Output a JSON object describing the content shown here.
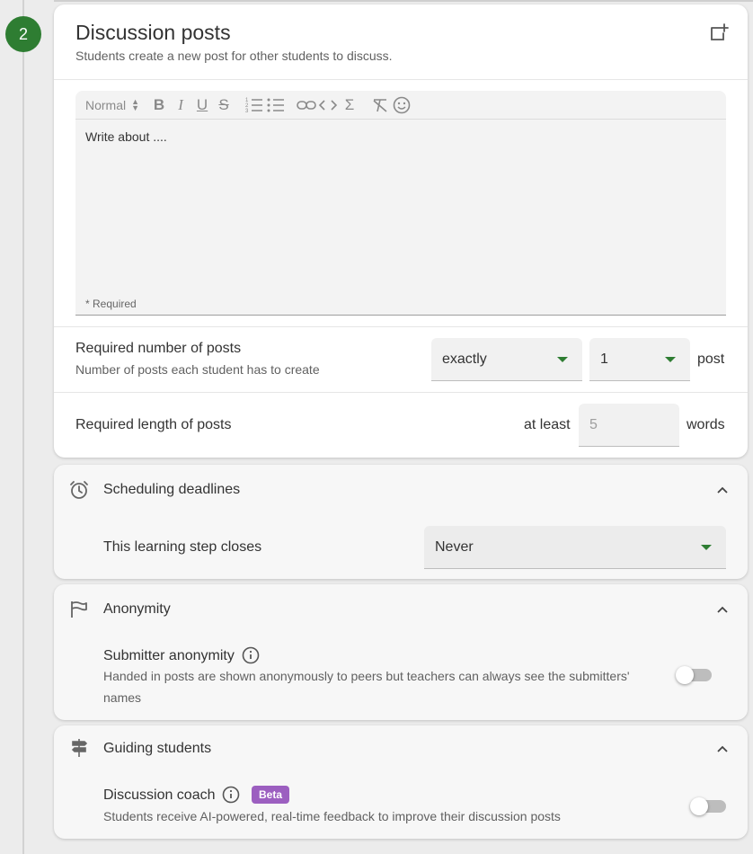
{
  "step": {
    "number": "2"
  },
  "discussion": {
    "title": "Discussion posts",
    "subtitle": "Students create a new post for other students to discuss.",
    "editor": {
      "format_label": "Normal",
      "content": "Write about ....",
      "required_note": "* Required"
    },
    "posts": {
      "label": "Required number of posts",
      "description": "Number of posts each student has to create",
      "comparator": "exactly",
      "count": "1",
      "unit": "post"
    },
    "length": {
      "label": "Required length of posts",
      "prefix": "at least",
      "placeholder": "5",
      "unit": "words"
    }
  },
  "scheduling": {
    "title": "Scheduling deadlines",
    "close_label": "This learning step closes",
    "close_value": "Never"
  },
  "anonymity": {
    "title": "Anonymity",
    "label": "Submitter anonymity",
    "description": "Handed in posts are shown anonymously to peers but teachers can always see the submitters' names",
    "enabled": false
  },
  "guiding": {
    "title": "Guiding students",
    "label": "Discussion coach",
    "badge": "Beta",
    "description": "Students receive AI-powered, real-time feedback to improve their discussion posts",
    "enabled": false
  },
  "colors": {
    "accent": "#2e7d32",
    "beta": "#9c5fc0"
  }
}
